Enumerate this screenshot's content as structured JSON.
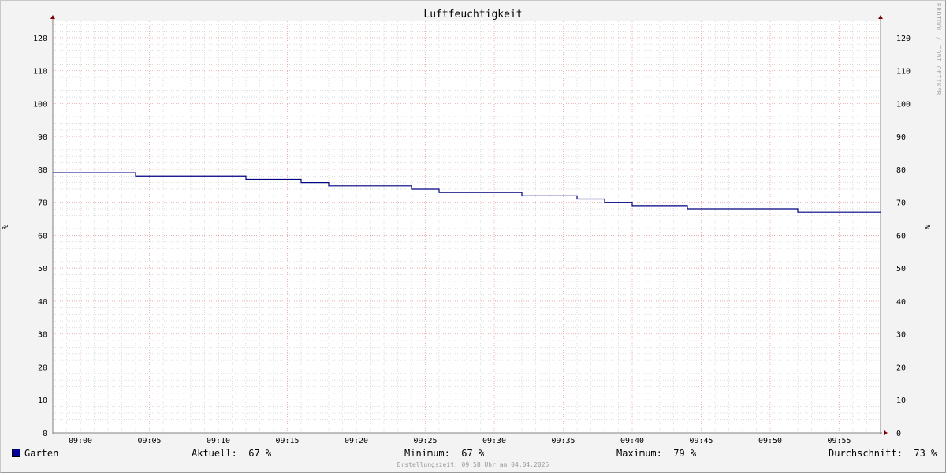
{
  "title": "Luftfeuchtigkeit",
  "watermark": "RRDTOOL / TOBI OETIKER",
  "chart_data": {
    "type": "line",
    "title": "Luftfeuchtigkeit",
    "ylabel": "%",
    "ylabel_right": "%",
    "xlabel": "",
    "ylim": [
      0,
      125
    ],
    "y_ticks": [
      0,
      10,
      20,
      30,
      40,
      50,
      60,
      70,
      80,
      90,
      100,
      110,
      120
    ],
    "x_range": [
      "08:58",
      "09:58"
    ],
    "x_ticks": [
      "09:00",
      "09:05",
      "09:10",
      "09:15",
      "09:20",
      "09:25",
      "09:30",
      "09:35",
      "09:40",
      "09:45",
      "09:50",
      "09:55"
    ],
    "grid": true,
    "legend": "bottom-left",
    "series": [
      {
        "name": "Garten",
        "color": "#000080",
        "step": true,
        "points": [
          [
            "08:58",
            79
          ],
          [
            "09:04",
            78
          ],
          [
            "09:12",
            77
          ],
          [
            "09:16",
            76
          ],
          [
            "09:18",
            75
          ],
          [
            "09:24",
            74
          ],
          [
            "09:26",
            73
          ],
          [
            "09:32",
            72
          ],
          [
            "09:36",
            71
          ],
          [
            "09:38",
            70
          ],
          [
            "09:40",
            69
          ],
          [
            "09:44",
            68
          ],
          [
            "09:52",
            67
          ],
          [
            "09:58",
            67
          ]
        ]
      }
    ]
  },
  "legend": {
    "series_name": "Garten",
    "swatch_color": "#000099",
    "current_label": "Aktuell:",
    "current_value": "67 %",
    "min_label": "Minimum:",
    "min_value": "67 %",
    "max_label": "Maximum:",
    "max_value": "79 %",
    "avg_label": "Durchschnitt:",
    "avg_value": "73 %"
  },
  "footer": "Erstellungszeit: 09:58 Uhr am 04.04.2025",
  "colors": {
    "background": "#f3f3f3",
    "plot_background": "#ffffff",
    "major_grid": "#e6a0a0",
    "minor_grid": "#c8c8c8",
    "axis": "#808080",
    "arrow": "#800000"
  }
}
